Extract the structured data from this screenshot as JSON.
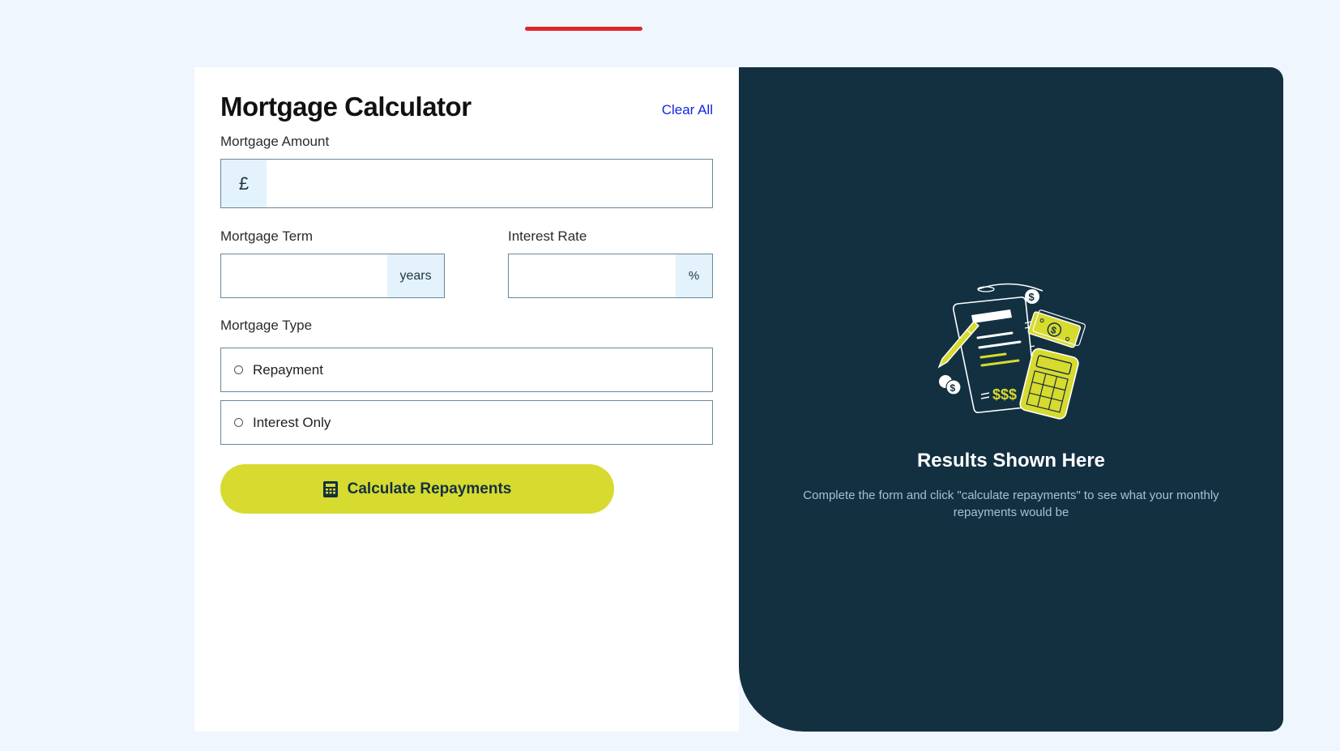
{
  "header": {
    "accent_color": "#e0242c"
  },
  "form": {
    "title": "Mortgage Calculator",
    "clear_all_label": "Clear All",
    "amount": {
      "label": "Mortgage Amount",
      "prefix": "£",
      "value": ""
    },
    "term": {
      "label": "Mortgage Term",
      "suffix": "years",
      "value": ""
    },
    "rate": {
      "label": "Interest Rate",
      "suffix": "%",
      "value": ""
    },
    "type": {
      "label": "Mortgage Type",
      "options": [
        {
          "label": "Repayment",
          "selected": false
        },
        {
          "label": "Interest Only",
          "selected": false
        }
      ]
    },
    "submit_label": "Calculate Repayments",
    "submit_icon": "calculator-icon"
  },
  "results": {
    "title": "Results Shown Here",
    "description": "Complete the form and click \"calculate repayments\" to see what your monthly repayments would be",
    "illustration": "empty-results-illustration"
  },
  "colors": {
    "page_background": "#eff6fd",
    "panel_dark": "#133041",
    "accent_lime": "#d7da2f",
    "link_blue": "#1424e6",
    "addon_background": "#e3f2fb",
    "muted_text": "#9fc2d6"
  }
}
